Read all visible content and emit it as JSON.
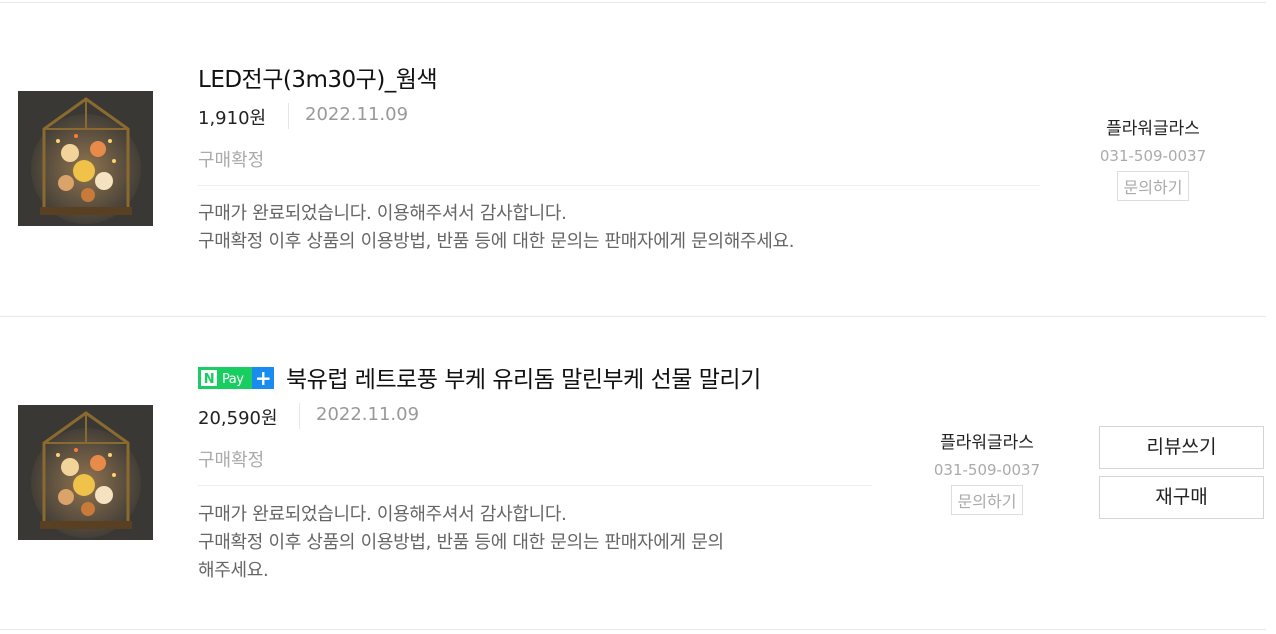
{
  "orders": [
    {
      "title": "LED전구(3m30구)_웜색",
      "has_npay_badge": false,
      "price": "1,910원",
      "date": "2022.11.09",
      "status": "구매확정",
      "message_line1": "구매가 완료되었습니다. 이용해주셔서 감사합니다.",
      "message_line2": "구매확정 이후 상품의 이용방법, 반품 등에 대한 문의는 판매자에게 문의해주세요.",
      "seller_name": "플라워글라스",
      "seller_phone": "031-509-0037",
      "inquiry_label": "문의하기"
    },
    {
      "title": "북유럽 레트로풍 부케 유리돔 말린부케 선물 말리기",
      "has_npay_badge": true,
      "npay_badge": {
        "n": "N",
        "pay": "Pay",
        "plus": "+"
      },
      "price": "20,590원",
      "date": "2022.11.09",
      "status": "구매확정",
      "message_line1": "구매가 완료되었습니다. 이용해주셔서 감사합니다.",
      "message_line2": "구매확정 이후 상품의 이용방법, 반품 등에 대한 문의는 판매자에게 문의",
      "message_line3": "해주세요.",
      "seller_name": "플라워글라스",
      "seller_phone": "031-509-0037",
      "inquiry_label": "문의하기",
      "review_button": "리뷰쓰기",
      "rebuy_button": "재구매"
    }
  ],
  "colors": {
    "npay_green": "#19ce60",
    "npay_blue": "#1a8cf0"
  }
}
